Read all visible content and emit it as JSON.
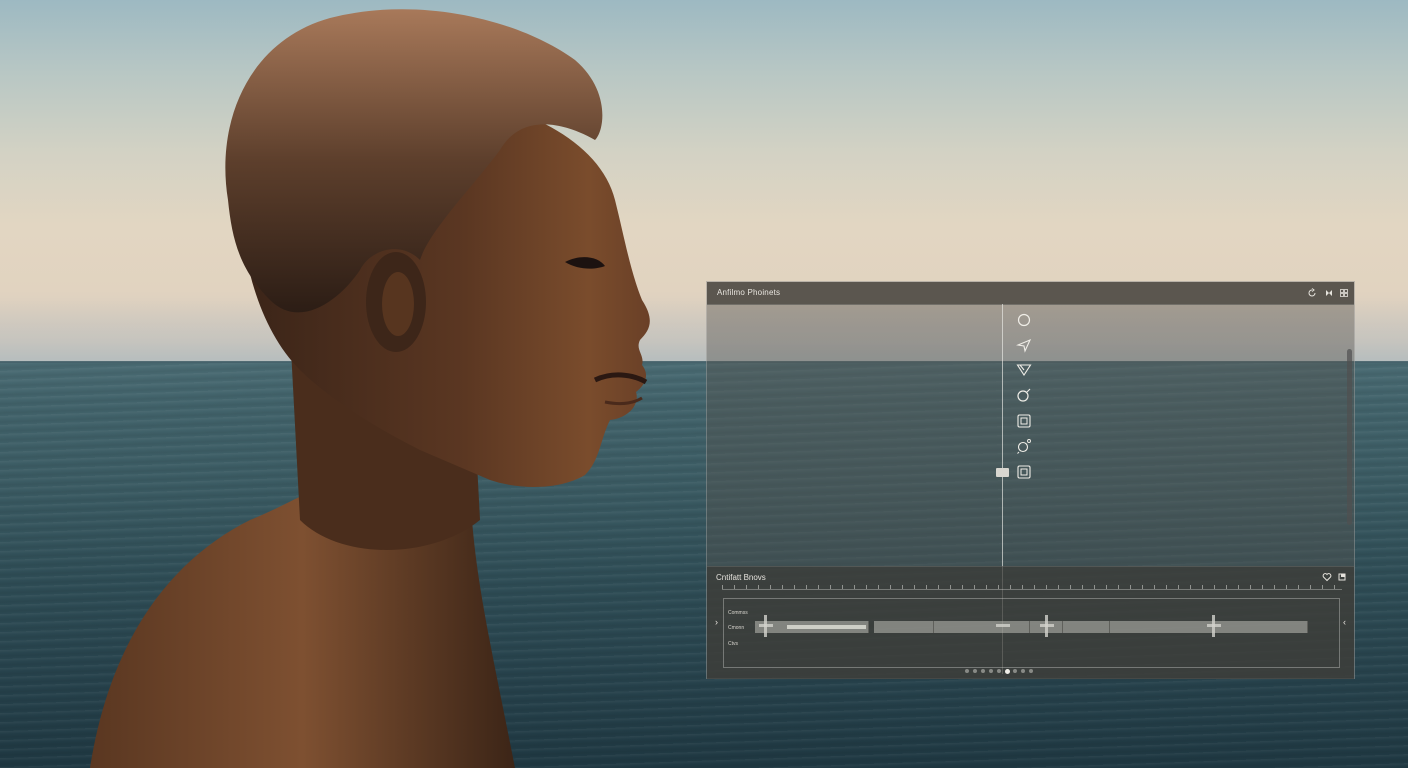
{
  "window": {
    "title": "Anfilmo Phoinets",
    "controls": [
      "refresh-icon",
      "bowtie-icon",
      "grid-icon"
    ]
  },
  "tools": [
    {
      "name": "circle-tool-icon"
    },
    {
      "name": "pen-arrow-tool-icon"
    },
    {
      "name": "triangle-tool-icon"
    },
    {
      "name": "ring-tool-icon"
    },
    {
      "name": "square-tool-icon"
    },
    {
      "name": "gear-tool-icon"
    },
    {
      "name": "frame-tool-icon"
    }
  ],
  "timeline": {
    "title": "Cntifatt Bnovs",
    "track_labels": [
      "Commss",
      "Cmonn",
      "Ctvs"
    ],
    "nav_left": "›",
    "nav_right": "‹",
    "page_count": 9,
    "active_page": 5
  },
  "colors": {
    "panel_bg": "#56544e",
    "panel_text": "#e9e6e0"
  }
}
